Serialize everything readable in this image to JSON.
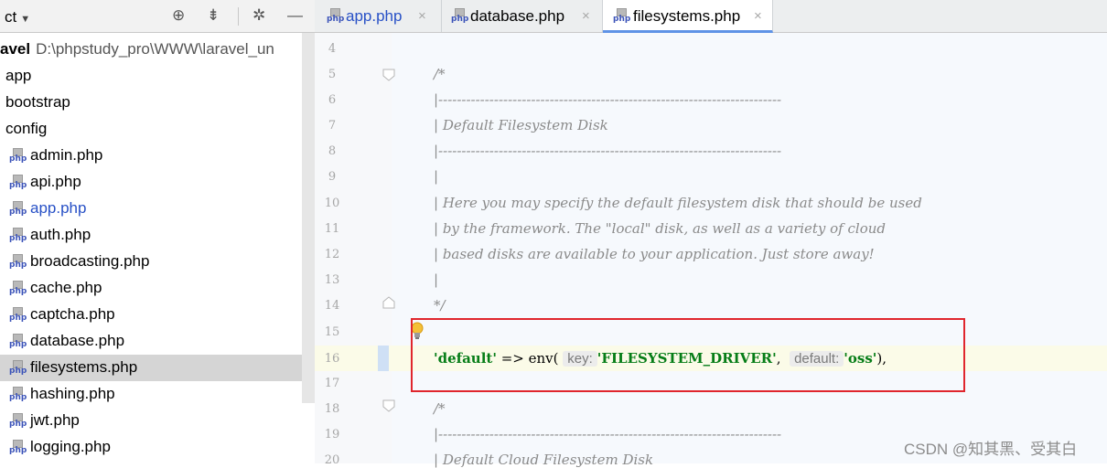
{
  "project_panel": {
    "title": "ct",
    "header_icons": [
      "globe-icon",
      "collapse-icon",
      "gear-icon",
      "minimize-icon"
    ],
    "root": {
      "name": "avel",
      "path": "D:\\phpstudy_pro\\WWW\\laravel_un"
    },
    "folders": [
      "app",
      "bootstrap",
      "config"
    ],
    "files": [
      "admin.php",
      "api.php",
      "app.php",
      "auth.php",
      "broadcasting.php",
      "cache.php",
      "captcha.php",
      "database.php",
      "filesystems.php",
      "hashing.php",
      "jwt.php",
      "logging.php"
    ],
    "selected_file": "filesystems.php",
    "link_file": "app.php"
  },
  "editor_tabs": [
    {
      "label": "app.php",
      "icon_label": "php",
      "active": false,
      "close": "×"
    },
    {
      "label": "database.php",
      "icon_label": "php",
      "active": false,
      "close": "×"
    },
    {
      "label": "filesystems.php",
      "icon_label": "php",
      "active": true,
      "close": "×"
    }
  ],
  "editor": {
    "line_numbers": [
      "4",
      "5",
      "6",
      "7",
      "8",
      "9",
      "10",
      "11",
      "12",
      "13",
      "14",
      "15",
      "16",
      "17",
      "18",
      "19",
      "20"
    ],
    "comment_lines": {
      "l5": "/*",
      "l6": "|--------------------------------------------------------------------------",
      "l7": "| Default Filesystem Disk",
      "l8": "|--------------------------------------------------------------------------",
      "l9": "|",
      "l10": "| Here you may specify the default filesystem disk that should be used",
      "l11": "| by the framework. The \"local\" disk, as well as a variety of cloud",
      "l12": "| based disks are available to your application. Just store away!",
      "l13": "|",
      "l14": "*/",
      "l18": "/*",
      "l19": "|--------------------------------------------------------------------------",
      "l20": "| Default Cloud Filesystem Disk"
    },
    "code_line": {
      "key": "'default'",
      "arrow": "=>",
      "func": "env(",
      "hint_key": "key:",
      "arg1": "'FILESYSTEM_DRIVER'",
      "comma": ",",
      "hint_default": "default:",
      "arg2": "'oss'",
      "end": "),"
    }
  },
  "watermark": "CSDN @知其黑、受其白",
  "colors": {
    "highlight_box": "#e0262d",
    "string": "#067d17",
    "active_tab_underline": "#5f93e6",
    "selection": "#d5d5d5"
  }
}
